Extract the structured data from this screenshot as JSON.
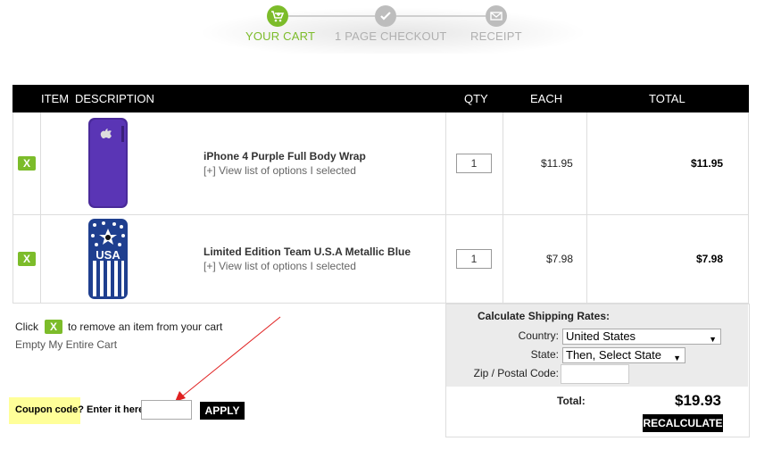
{
  "steps": [
    {
      "label": "YOUR CART",
      "state": "active",
      "icon": "cart-add-icon"
    },
    {
      "label": "1 PAGE CHECKOUT",
      "state": "pending",
      "icon": "checkmark-icon"
    },
    {
      "label": "RECEIPT",
      "state": "pending",
      "icon": "envelope-icon"
    }
  ],
  "colors": {
    "active": "#7cbc2a",
    "pending": "#bdbdbd",
    "pending_text": "#b0b0b0"
  },
  "table": {
    "headers": {
      "item": "ITEM",
      "description": "DESCRIPTION",
      "qty": "QTY",
      "each": "EACH",
      "total": "TOTAL"
    },
    "rows": [
      {
        "remove": "X",
        "image": "purple-phone-wrap",
        "name": "iPhone 4 Purple Full Body Wrap",
        "options": "[+] View list of options I selected",
        "qty": "1",
        "each": "$11.95",
        "total": "$11.95"
      },
      {
        "remove": "X",
        "image": "usa-phone-wrap",
        "name": "Limited Edition Team U.S.A Metallic Blue",
        "options": "[+] View list of options I selected",
        "qty": "1",
        "each": "$7.98",
        "total": "$7.98"
      }
    ]
  },
  "cart_notes": {
    "click": "Click",
    "remove_x": "X",
    "remove_text": "to remove an item from your cart",
    "empty_link": "Empty My Entire Cart"
  },
  "coupon": {
    "label": "Coupon code? Enter it here:",
    "value": "",
    "apply": "APPLY"
  },
  "shipping": {
    "title": "Calculate Shipping Rates:",
    "country_label": "Country:",
    "country_value": "United States",
    "state_label": "State:",
    "state_value": "Then, Select State",
    "zip_label": "Zip / Postal Code:",
    "zip_value": "",
    "total_label": "Total:",
    "total_value": "$19.93",
    "recalculate": "RECALCULATE"
  }
}
